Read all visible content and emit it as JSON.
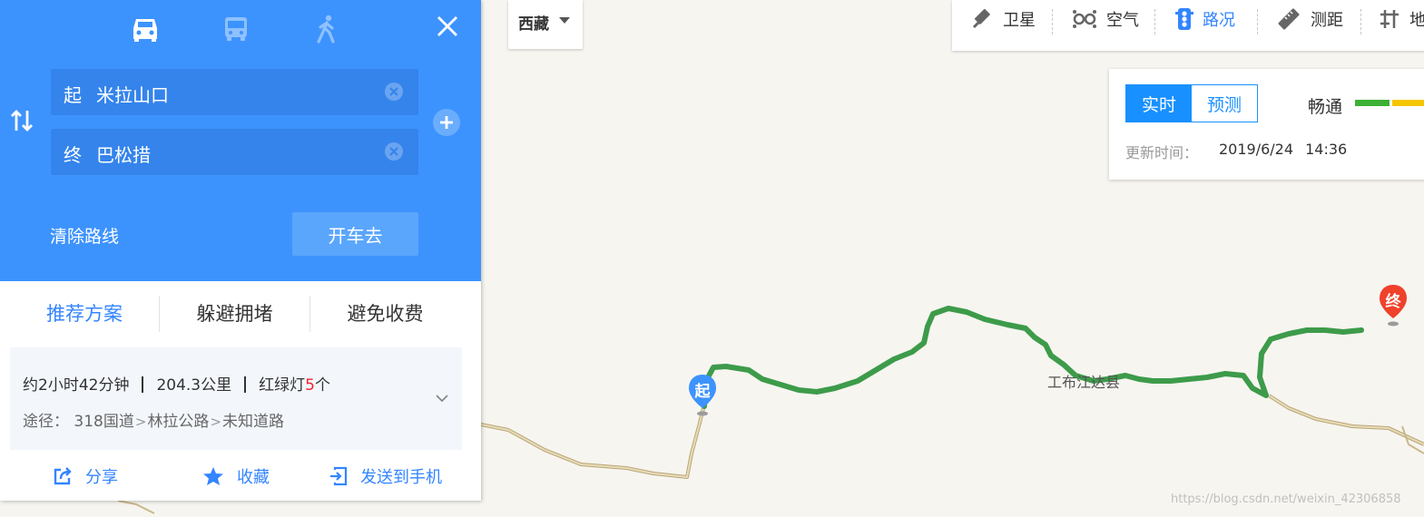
{
  "route_panel": {
    "modes": [
      {
        "icon": "car-icon",
        "active": true
      },
      {
        "icon": "bus-icon",
        "active": false
      },
      {
        "icon": "walk-icon",
        "active": false
      }
    ],
    "start": {
      "tag": "起",
      "value": "米拉山口"
    },
    "end": {
      "tag": "终",
      "value": "巴松措"
    },
    "clear_route_label": "清除路线",
    "drive_label": "开车去"
  },
  "tabs": [
    {
      "label": "推荐方案",
      "active": true
    },
    {
      "label": "躲避拥堵",
      "active": false
    },
    {
      "label": "避免收费",
      "active": false
    }
  ],
  "summary": {
    "duration": "约2小时42分钟",
    "distance": "204.3公里",
    "lights_prefix": "红绿灯",
    "lights_count": "5",
    "lights_suffix": "个",
    "via_label": "途径：",
    "via": [
      "318国道",
      "林拉公路",
      "未知道路"
    ]
  },
  "actions": [
    {
      "label": "分享",
      "icon": "share-icon"
    },
    {
      "label": "收藏",
      "icon": "star-icon"
    },
    {
      "label": "发送到手机",
      "icon": "send-to-phone-icon"
    }
  ],
  "region": {
    "label": "西藏"
  },
  "toolbar": {
    "items": [
      {
        "label": "卫星",
        "icon": "satellite-icon",
        "active": false
      },
      {
        "label": "空气",
        "icon": "air-icon",
        "active": false
      },
      {
        "label": "路况",
        "icon": "traffic-light-icon",
        "active": true
      },
      {
        "label": "测距",
        "icon": "ruler-icon",
        "active": false
      },
      {
        "label": "地",
        "icon": "subway-icon",
        "active": false
      }
    ]
  },
  "traffic": {
    "realtime_label": "实时",
    "forecast_label": "预测",
    "legend_label": "畅通",
    "update_label": "更新时间：",
    "update_value": "2019/6/24 14:36",
    "colors": {
      "smooth": "#3cb034",
      "slow": "#f5c600"
    }
  },
  "map": {
    "start_marker": "起",
    "end_marker": "终",
    "place_label": "工布江达县",
    "route_color": "#3d9b4a",
    "watermark": "https://blog.csdn.net/weixin_42306858"
  }
}
